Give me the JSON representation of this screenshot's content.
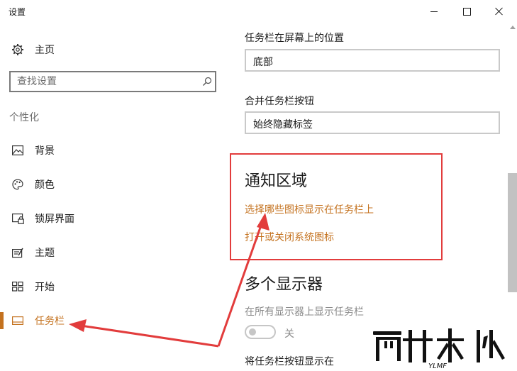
{
  "window": {
    "title": "设置"
  },
  "sidebar": {
    "home_label": "主页",
    "search_placeholder": "查找设置",
    "section_title": "个性化",
    "items": [
      {
        "label": "背景",
        "icon": "picture-icon"
      },
      {
        "label": "颜色",
        "icon": "palette-icon"
      },
      {
        "label": "锁屏界面",
        "icon": "lock-screen-icon"
      },
      {
        "label": "主题",
        "icon": "theme-icon"
      },
      {
        "label": "开始",
        "icon": "start-icon"
      },
      {
        "label": "任务栏",
        "icon": "taskbar-icon",
        "active": true
      }
    ]
  },
  "content": {
    "position_label": "任务栏在屏幕上的位置",
    "position_value": "底部",
    "combine_label": "合并任务栏按钮",
    "combine_value": "始终隐藏标签",
    "notification_heading": "通知区域",
    "link_choose_icons": "选择哪些图标显示在任务栏上",
    "link_system_icons": "打开或关闭系统图标",
    "multi_display_heading": "多个显示器",
    "show_taskbar_all_label": "在所有显示器上显示任务栏",
    "toggle_state": "关",
    "show_buttons_label": "将任务栏按钮显示在"
  },
  "colors": {
    "accent": "#c4721f",
    "annotation_red": "#e23c3c"
  }
}
